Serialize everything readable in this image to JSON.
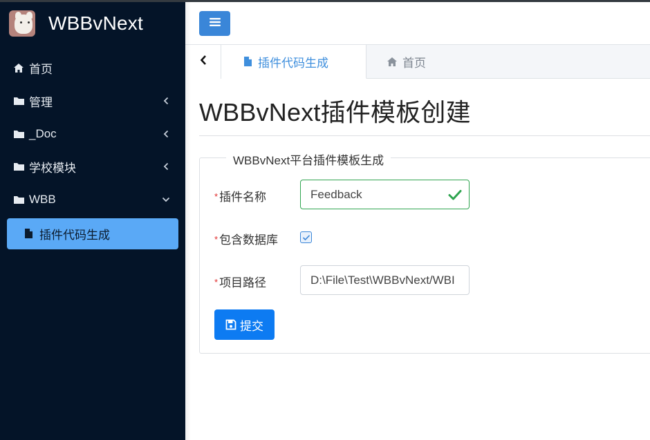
{
  "brand": {
    "name": "WBBvNext"
  },
  "sidebar": {
    "items": [
      {
        "label": "首页",
        "icon": "home-icon"
      },
      {
        "label": "管理",
        "icon": "folder-icon",
        "chevron": "chevron-left-icon"
      },
      {
        "label": "_Doc",
        "icon": "folder-icon",
        "chevron": "chevron-left-icon"
      },
      {
        "label": "学校模块",
        "icon": "folder-icon",
        "chevron": "chevron-left-icon"
      },
      {
        "label": "WBB",
        "icon": "folder-icon",
        "chevron": "chevron-down-icon",
        "expanded": true
      }
    ],
    "active_subitem": {
      "label": "插件代码生成",
      "icon": "file-icon"
    }
  },
  "topbar": {
    "menu_icon": "bars-icon"
  },
  "tabs": [
    {
      "label": "插件代码生成",
      "icon": "file-icon",
      "active": true
    },
    {
      "label": "首页",
      "icon": "home-icon",
      "active": false
    }
  ],
  "page": {
    "title": "WBBvNext插件模板创建",
    "form": {
      "legend": "WBBvNext平台插件模板生成",
      "required_mark": "*",
      "plugin_name": {
        "label": "插件名称",
        "value": "Feedback",
        "valid": true
      },
      "include_db": {
        "label": "包含数据库",
        "checked": true
      },
      "project_path": {
        "label": "项目路径",
        "value": "D:\\File\\Test\\WBBvNext/WBI"
      },
      "submit_label": "提交"
    }
  },
  "colors": {
    "sidebar_bg": "#041428",
    "active_item_bg": "#5aa9f6",
    "primary": "#0d7bf2",
    "tab_active": "#3f8fdd",
    "valid": "#2ea44f",
    "required": "#e02a2a"
  }
}
